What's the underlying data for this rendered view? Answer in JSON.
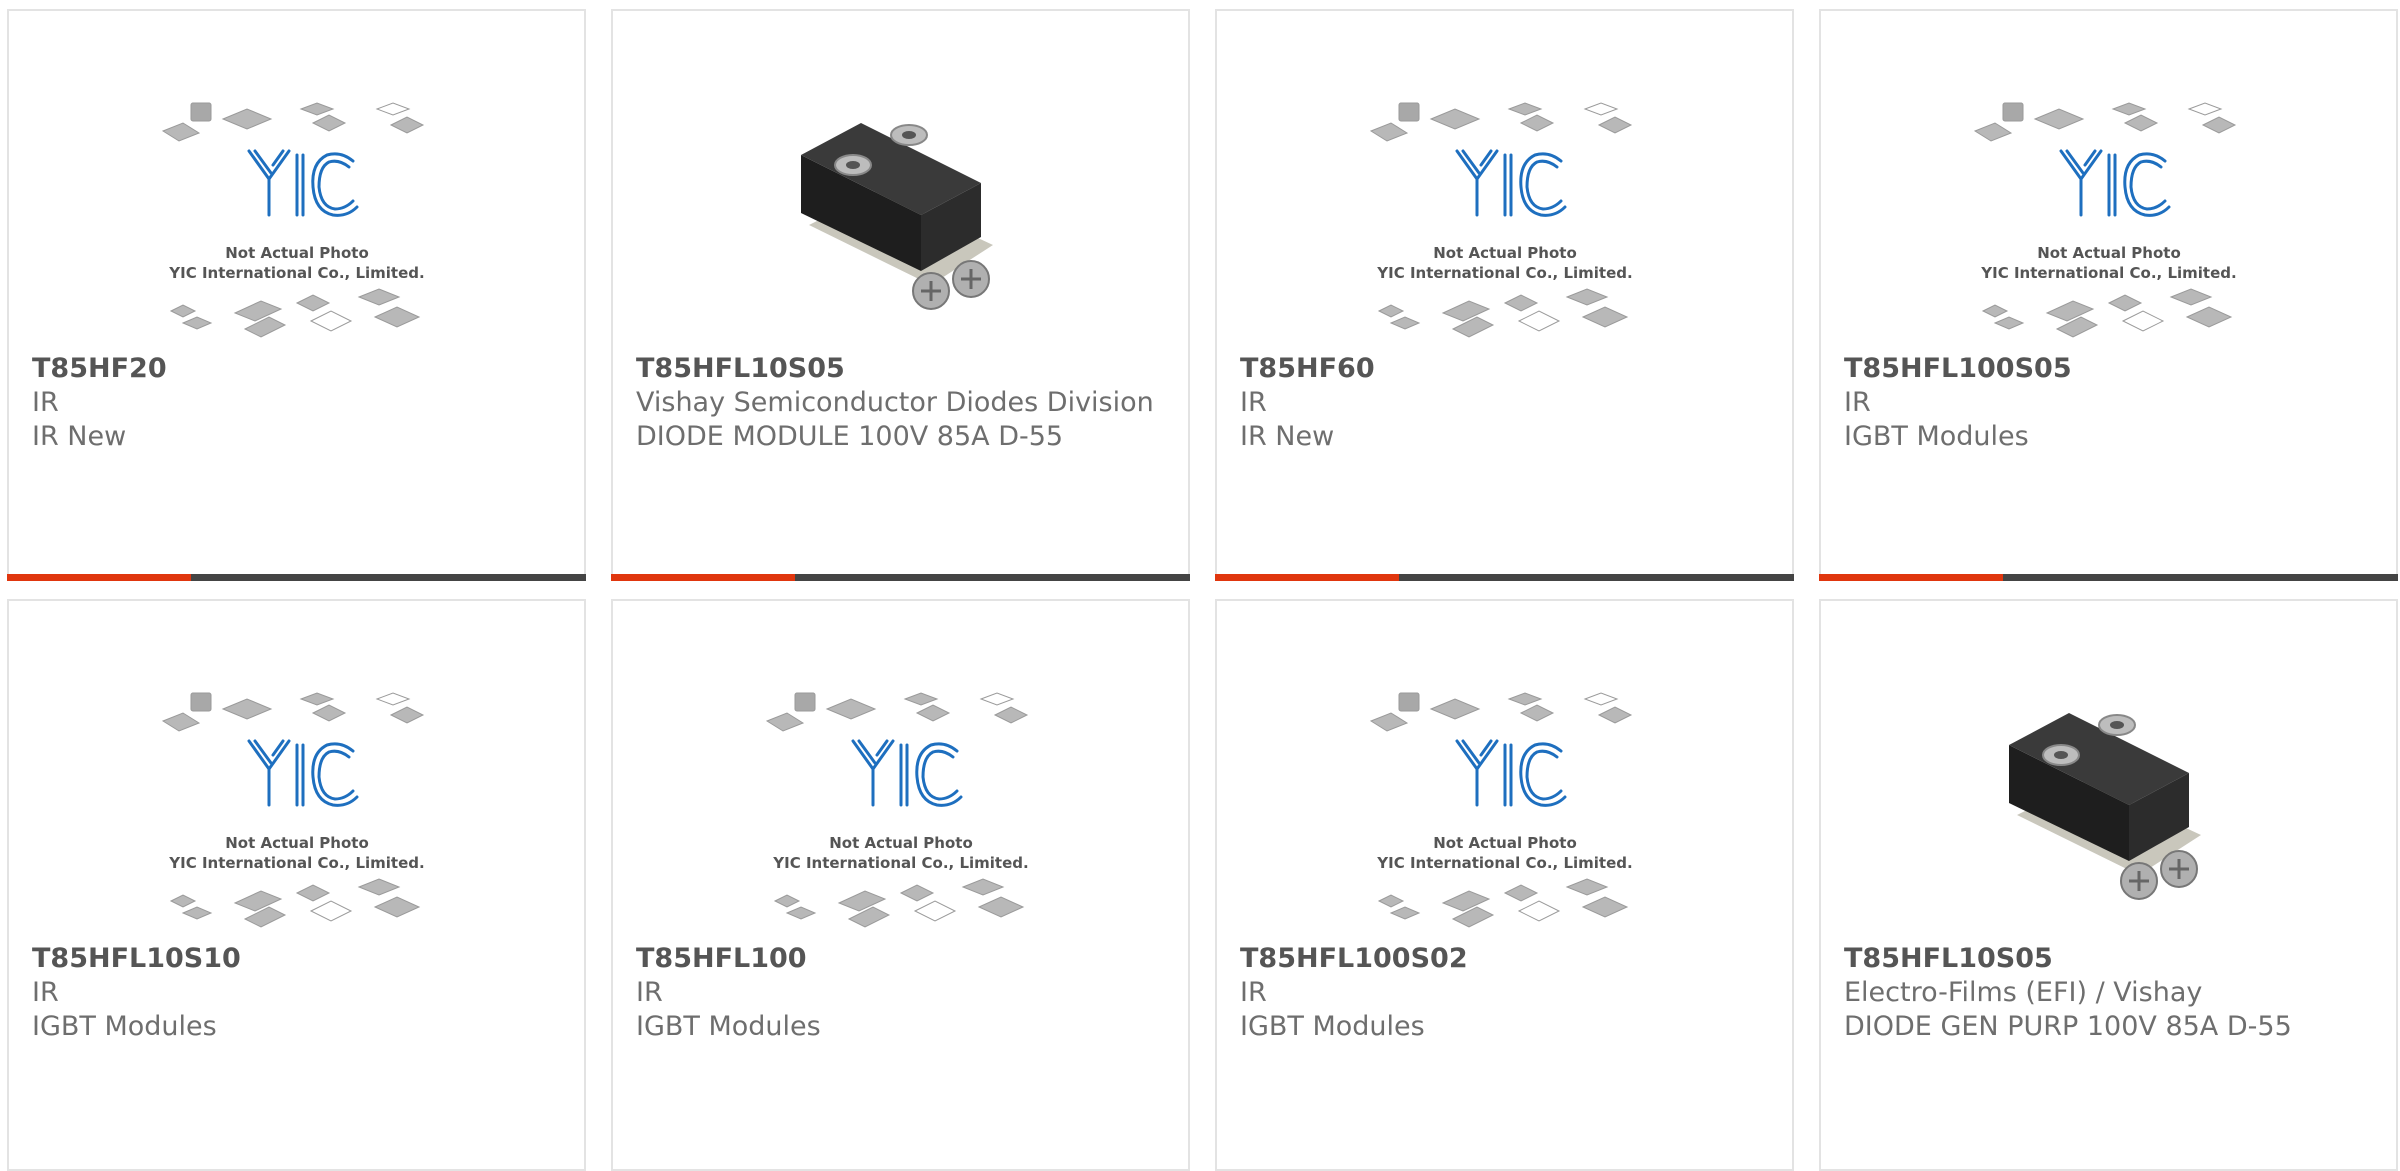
{
  "products": [
    {
      "part_number": "T85HF20",
      "manufacturer": "IR",
      "description": "IR New",
      "image": "placeholder"
    },
    {
      "part_number": "T85HFL10S05",
      "manufacturer": "Vishay Semiconductor Diodes Division",
      "description": "DIODE MODULE 100V 85A D-55",
      "image": "module"
    },
    {
      "part_number": "T85HF60",
      "manufacturer": "IR",
      "description": "IR New",
      "image": "placeholder"
    },
    {
      "part_number": "T85HFL100S05",
      "manufacturer": "IR",
      "description": "IGBT Modules",
      "image": "placeholder"
    },
    {
      "part_number": "T85HFL10S10",
      "manufacturer": "IR",
      "description": "IGBT Modules",
      "image": "placeholder"
    },
    {
      "part_number": "T85HFL100",
      "manufacturer": "IR",
      "description": "IGBT Modules",
      "image": "placeholder"
    },
    {
      "part_number": "T85HFL100S02",
      "manufacturer": "IR",
      "description": "IGBT Modules",
      "image": "placeholder"
    },
    {
      "part_number": "T85HFL10S05",
      "manufacturer": "Electro-Films (EFI) / Vishay",
      "description": "DIODE GEN PURP 100V 85A D-55",
      "image": "module"
    }
  ],
  "placeholder_image": {
    "line1": "Not Actual Photo",
    "line2": "YIC International Co., Limited.",
    "logo_text": "YIC"
  },
  "colors": {
    "accent": "#e0360e",
    "bar": "#444444",
    "logo_blue": "#1e6fbf"
  }
}
